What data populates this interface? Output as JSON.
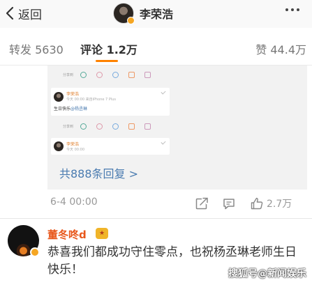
{
  "header": {
    "back_label": "返回",
    "title": "李荣浩"
  },
  "tabs": {
    "repost": "转发 5630",
    "comment": "评论 1.2万",
    "like": "赞 44.4万"
  },
  "embedded": {
    "share_label_1": "分享到",
    "share_label_2": "分享到",
    "share_label_3": "分享到",
    "card1": {
      "name": "李荣浩",
      "meta": "今天 00:00  来自iPhone 7 Plus",
      "text": "生日快乐",
      "mention": "@杨丞琳"
    },
    "card2": {
      "name": "李荣浩",
      "meta": "今天 00:00"
    }
  },
  "replies": {
    "label": "共888条回复 >"
  },
  "comment_meta": {
    "date": "6-4 00:00",
    "like_count": "2.7万"
  },
  "comment2": {
    "name": "董冬咚d",
    "text": "恭喜我们都成功守住零点，也祝杨丞琳老师生日快乐！"
  },
  "watermark": "搜狐号@新闻娱乐",
  "colors": {
    "accent_orange": "#ff8200",
    "link_blue": "#4a7bb0",
    "name_orange": "#e8571b"
  }
}
